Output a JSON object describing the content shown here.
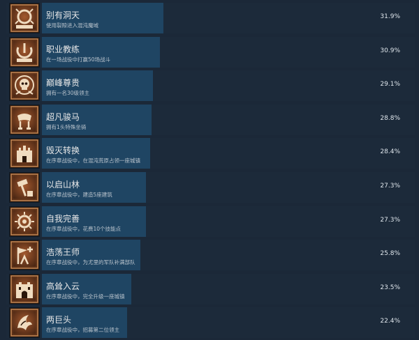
{
  "achievements": [
    {
      "title": "别有洞天",
      "description": "使用裂隙进入混沌魔域",
      "percent_label": "31.9%",
      "percent": 31.9,
      "icon": "chaos-wreath-icon"
    },
    {
      "title": "职业教练",
      "description": "在一场战役中打赢50场战斗",
      "percent_label": "30.9%",
      "percent": 30.9,
      "icon": "power-sigil-icon"
    },
    {
      "title": "巅峰尊贵",
      "description": "拥有一名30级领主",
      "percent_label": "29.1%",
      "percent": 29.1,
      "icon": "skull-emblem-icon"
    },
    {
      "title": "超凡骏马",
      "description": "拥有1头特殊坐骑",
      "percent_label": "28.8%",
      "percent": 28.8,
      "icon": "saddle-icon"
    },
    {
      "title": "毁灭转换",
      "description": "在序章战役中，在混沌荒原占领一座城镇",
      "percent_label": "28.4%",
      "percent": 28.4,
      "icon": "ruined-castle-icon"
    },
    {
      "title": "以启山林",
      "description": "在序章战役中，建造5座建筑",
      "percent_label": "27.3%",
      "percent": 27.3,
      "icon": "hammer-icon"
    },
    {
      "title": "自我完善",
      "description": "在序章战役中，花费10个技能点",
      "percent_label": "27.3%",
      "percent": 27.3,
      "icon": "sun-ring-icon"
    },
    {
      "title": "浩荡王师",
      "description": "在序章战役中，为尤里的军队补满部队",
      "percent_label": "25.8%",
      "percent": 25.8,
      "icon": "banner-plus-icon"
    },
    {
      "title": "高耸入云",
      "description": "在序章战役中，完全升级一座城镇",
      "percent_label": "23.5%",
      "percent": 23.5,
      "icon": "fortress-icon"
    },
    {
      "title": "两巨头",
      "description": "在序章战役中，招募第二位领主",
      "percent_label": "22.4%",
      "percent": 22.4,
      "icon": "claw-icon"
    }
  ]
}
